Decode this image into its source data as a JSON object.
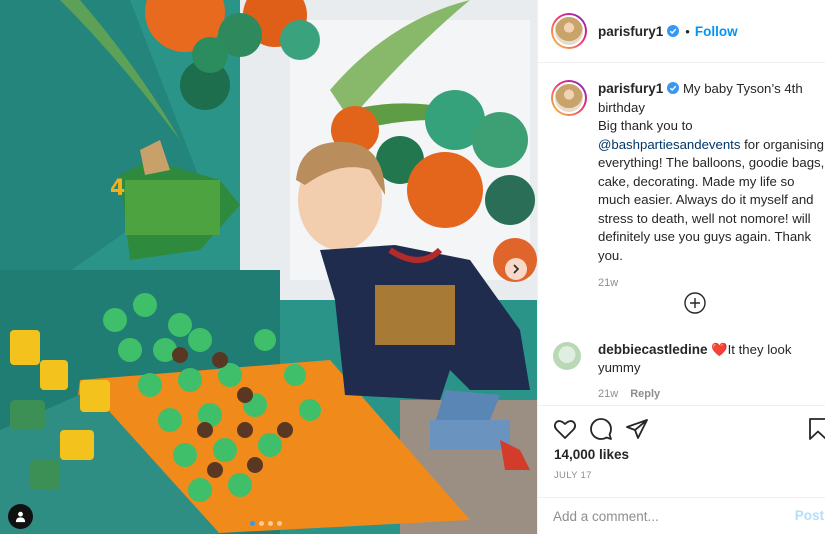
{
  "post": {
    "username": "parisfury1",
    "follow_separator": "•",
    "follow_label": "Follow",
    "photo_alt": "Child standing beside dinosaur-themed birthday cake and cupcakes",
    "carousel": {
      "total": 4,
      "current": 1
    }
  },
  "caption": {
    "username": "parisfury1",
    "text_line_1": " My baby Tyson’s 4th birthday\nBig thank you to\n",
    "mention": "@bashpartiesandevents",
    "text_line_2": " for organising everything! The balloons, goodie bags, cake, decorating. Made my life so much easier. Always do it myself and stress to death, well not nomore! will definitely use you guys again. Thank you.",
    "time": "21w"
  },
  "comment": {
    "username": "debbiecastledine",
    "emoji": "❤️",
    "text": "It they look yummy",
    "time": "21w",
    "reply_label": "Reply"
  },
  "actions": {
    "likes": "14,000 likes",
    "date": "JULY 17"
  },
  "add_comment": {
    "placeholder": "Add a comment...",
    "post_label": "Post"
  },
  "colors": {
    "follow": "#0095f6",
    "post_disabled": "#b2dffc",
    "carousel_active": "#3897f0",
    "muted": "#8e8e8e"
  },
  "icons": [
    "chevron-right-icon",
    "user-tag-icon",
    "verified-badge-icon",
    "plus-circle-icon",
    "heart-icon",
    "comment-icon",
    "share-icon",
    "bookmark-icon"
  ]
}
